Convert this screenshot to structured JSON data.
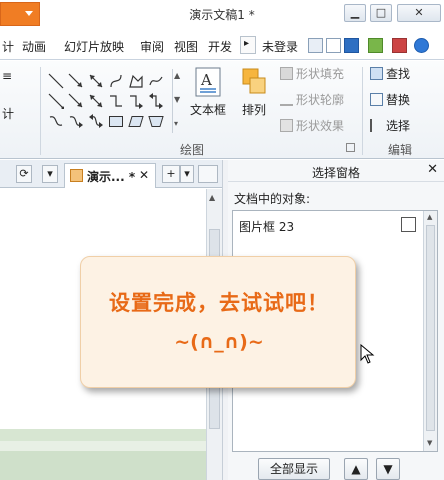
{
  "window": {
    "title": "演示文稿1 *",
    "minimize_glyph": "▁",
    "maximize_glyph": "□",
    "close_glyph": "✕"
  },
  "menu": {
    "items": [
      "计",
      "动画",
      "幻灯片放映",
      "审阅",
      "视图",
      "开发"
    ],
    "more_glyph": "▸",
    "login": "未登录"
  },
  "ribbon": {
    "textbox_label": "文本框",
    "arrange_label": "排列",
    "shape_fill": "形状填充",
    "shape_outline": "形状轮廓",
    "shape_effect": "形状效果",
    "find": "查找",
    "replace": "替换",
    "select": "选择",
    "group_drawing": "绘图",
    "group_editing": "编辑",
    "left_fragment": "计"
  },
  "docbar": {
    "tab_label": "演示... *",
    "tab_close": "✕",
    "add": "+",
    "add_menu": "▾",
    "history": "⟳",
    "list": "▾"
  },
  "pane": {
    "title": "选择窗格",
    "close": "✕",
    "subtitle": "文档中的对象:",
    "objects": [
      {
        "name": "图片框 23"
      }
    ],
    "show_all": "全部显示",
    "up": "▲",
    "down": "▼"
  },
  "callout": {
    "line1": "设置完成，去试试吧！",
    "line2": "~(∩_∩)~"
  },
  "icons": {
    "accent": "#f07d24",
    "callout_text": "#e86a17"
  }
}
